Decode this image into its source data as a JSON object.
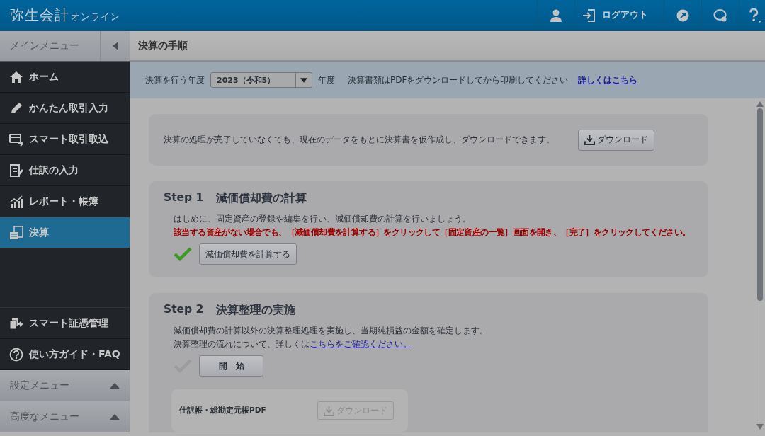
{
  "header": {
    "logo": "弥生会計",
    "logo_suffix": "オンライン",
    "logout": "ログアウト"
  },
  "sidebar": {
    "title": "メインメニュー",
    "items": [
      {
        "label": "ホーム",
        "selected": false
      },
      {
        "label": "かんたん取引入力",
        "selected": false
      },
      {
        "label": "スマート取引取込",
        "selected": false
      },
      {
        "label": "仕訳の入力",
        "selected": false
      },
      {
        "label": "レポート・帳簿",
        "selected": false
      },
      {
        "label": "決算",
        "selected": true
      }
    ],
    "bottom_items": [
      {
        "label": "スマート証憑管理"
      },
      {
        "label": "使い方ガイド・FAQ"
      }
    ],
    "sections": [
      {
        "label": "設定メニュー",
        "expanded": false
      },
      {
        "label": "高度なメニュー",
        "expanded": false
      }
    ]
  },
  "page_title": "決算の手順",
  "year_bar": {
    "label": "決算を行う年度",
    "value": "2023（令和5）",
    "suffix": "年度",
    "note": "決算書類はPDFをダウンロードしてから印刷してください",
    "link": "詳しくはこちら"
  },
  "preview": {
    "text": "決算の処理が完了していなくても、現在のデータをもとに決算書を仮作成し、ダウンロードできます。",
    "button": {
      "label": "ダウンロード",
      "disabled": false
    }
  },
  "steps": [
    {
      "step": "Step 1",
      "title": "減価償却費の計算",
      "lines": [
        {
          "kind": "normal",
          "text": "はじめに、固定資産の登録や編集を行い、減価償却費の計算を行いましょう。"
        },
        {
          "kind": "warning",
          "text": "該当する資産がない場合でも、［減価償却費を計算する］をクリックして［固定資産の一覧］画面を開き、［完了］をクリックしてください。"
        }
      ],
      "done": true,
      "button": "減価償却費を計算する"
    },
    {
      "step": "Step 2",
      "title": "決算整理の実施",
      "lines": [
        {
          "kind": "normal",
          "text": "減価償却費の計算以外の決算整理処理を実施し、当期純損益の金額を確定します。"
        },
        {
          "kind": "link",
          "text": "決算整理の流れについて、詳しくは",
          "link": "こちらをご確認ください。"
        }
      ],
      "done": false,
      "button": "開　始",
      "sub": {
        "label": "仕訳帳・総勘定元帳PDF",
        "button": {
          "label": "ダウンロード",
          "disabled": true
        }
      }
    }
  ]
}
